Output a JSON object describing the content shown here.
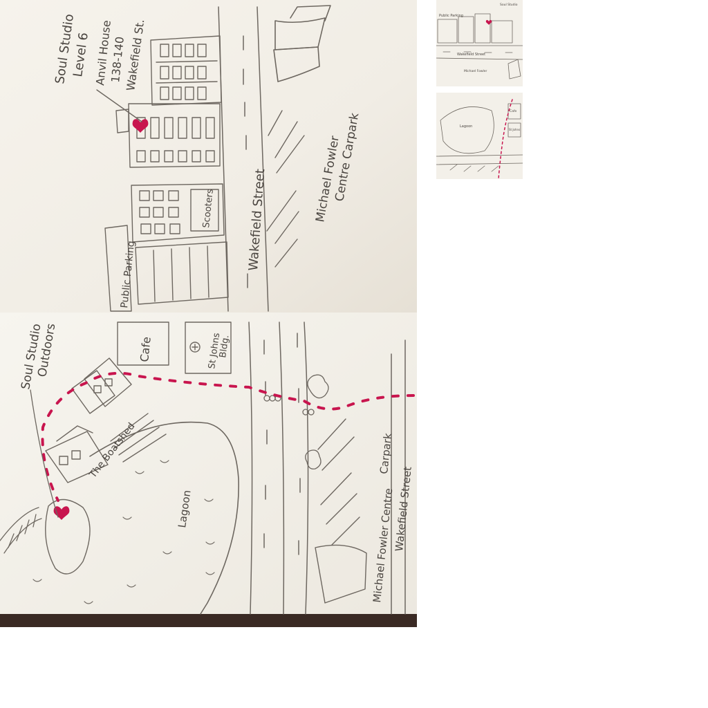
{
  "map_top": {
    "destination_name": "Soul Studio",
    "destination_level": "Level 6",
    "building_name": "Anvil House",
    "address_numbers": "138-140",
    "address_street": "Wakefield St.",
    "street_label": "Wakefield Street",
    "carpark_line1": "Michael Fowler",
    "carpark_line2": "Centre Carpark",
    "parking_label": "Public Parking",
    "shop_label": "Scooters"
  },
  "map_bottom": {
    "destination_line1": "Soul Studio",
    "destination_line2": "Outdoors",
    "cafe_label": "Cafe",
    "building_line1": "St Johns",
    "building_line2": "Bldg.",
    "boatshed_label": "The Boatshed",
    "lagoon_label": "Lagoon",
    "carpark_line1": "Michael Fowler Centre",
    "carpark_line2": "Carpark",
    "street_label": "Wakefield Street"
  },
  "colors": {
    "paper": "#f4f1ea",
    "paper_shadow": "#e7e2d8",
    "pencil": "#6d6760",
    "marker": "#c8154e"
  },
  "icons": {
    "destination_marker": "heart-icon",
    "route": "dashed-route-line"
  }
}
